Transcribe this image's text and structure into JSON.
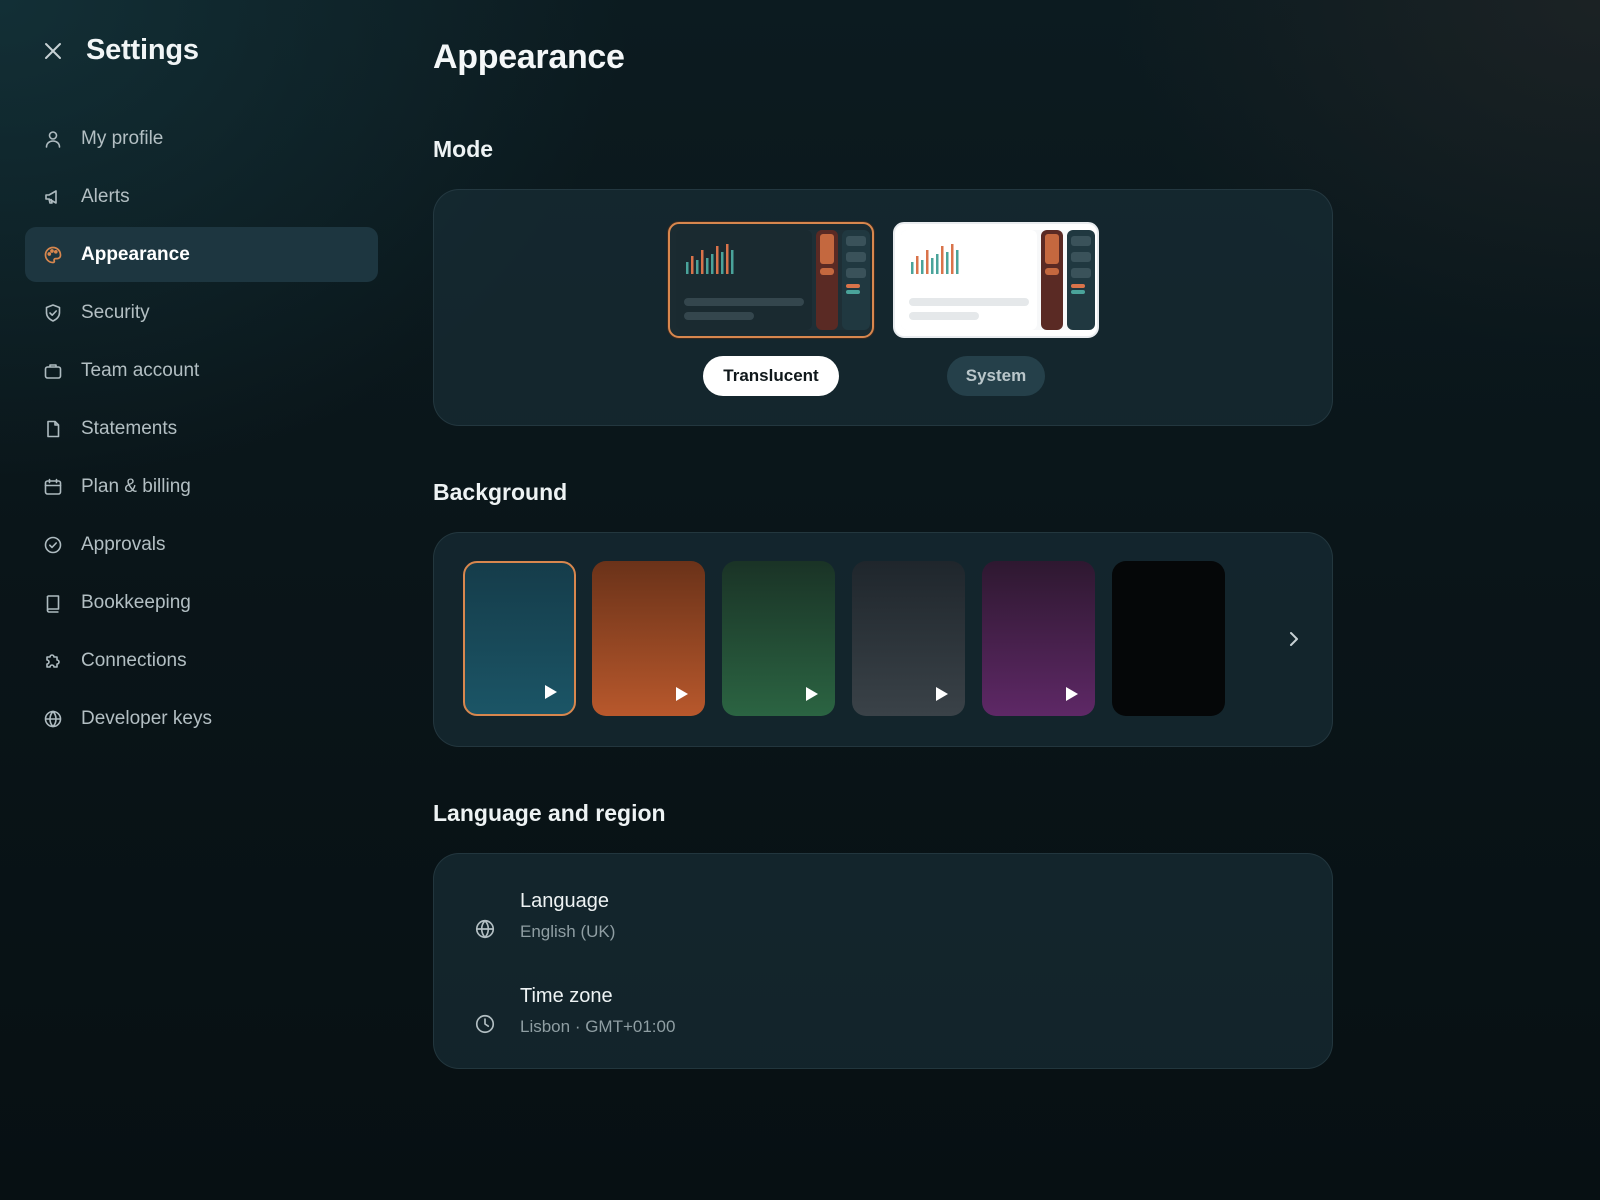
{
  "sidebar": {
    "title": "Settings",
    "items": [
      {
        "label": "My profile",
        "icon": "user-icon",
        "active": false
      },
      {
        "label": "Alerts",
        "icon": "megaphone-icon",
        "active": false
      },
      {
        "label": "Appearance",
        "icon": "palette-icon",
        "active": true
      },
      {
        "label": "Security",
        "icon": "shield-check-icon",
        "active": false
      },
      {
        "label": "Team account",
        "icon": "briefcase-icon",
        "active": false
      },
      {
        "label": "Statements",
        "icon": "document-icon",
        "active": false
      },
      {
        "label": "Plan & billing",
        "icon": "calendar-icon",
        "active": false
      },
      {
        "label": "Approvals",
        "icon": "check-circle-icon",
        "active": false
      },
      {
        "label": "Bookkeeping",
        "icon": "book-icon",
        "active": false
      },
      {
        "label": "Connections",
        "icon": "puzzle-icon",
        "active": false
      },
      {
        "label": "Developer keys",
        "icon": "globe-icon",
        "active": false
      }
    ]
  },
  "main": {
    "title": "Appearance",
    "mode": {
      "heading": "Mode",
      "options": [
        {
          "label": "Translucent",
          "selected": true
        },
        {
          "label": "System",
          "selected": false
        }
      ]
    },
    "background": {
      "heading": "Background",
      "swatches": [
        {
          "name": "teal",
          "color_top": "#153c4a",
          "color_bottom": "#1b5566",
          "animated": true,
          "selected": true
        },
        {
          "name": "orange",
          "color_top": "#6a3219",
          "color_bottom": "#b8582c",
          "animated": true,
          "selected": false
        },
        {
          "name": "green",
          "color_top": "#1a3326",
          "color_bottom": "#2b6442",
          "animated": true,
          "selected": false
        },
        {
          "name": "slate",
          "color_top": "#1f262c",
          "color_bottom": "#3a4248",
          "animated": true,
          "selected": false
        },
        {
          "name": "purple",
          "color_top": "#2e1830",
          "color_bottom": "#5e2866",
          "animated": true,
          "selected": false
        },
        {
          "name": "black",
          "color_top": "#050708",
          "color_bottom": "#050708",
          "animated": false,
          "selected": false
        }
      ]
    },
    "language_region": {
      "heading": "Language and region",
      "rows": [
        {
          "title": "Language",
          "value": "English (UK)",
          "icon": "globe-icon"
        },
        {
          "title": "Time zone",
          "value": "Lisbon · GMT+01:00",
          "icon": "clock-icon"
        }
      ]
    }
  },
  "colors": {
    "accent": "#d8874e",
    "active_nav_bg": "#1d3640",
    "card_bg": "#182c34",
    "chart_orange": "#d9734a",
    "chart_teal": "#4aa39a"
  }
}
